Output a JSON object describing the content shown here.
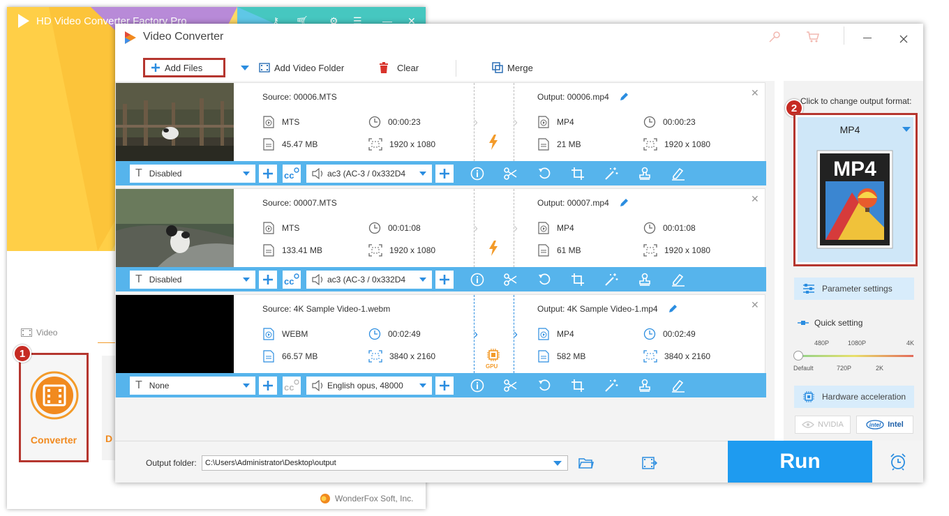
{
  "bg_window": {
    "title": "HD Video Converter Factory Pro",
    "section_label": "Video",
    "converter_label": "Converter",
    "next_label": "D",
    "brand": "WonderFox Soft, Inc.",
    "badge1": "1"
  },
  "window": {
    "title": "Video Converter",
    "toolbar": {
      "add_files": "Add Files",
      "add_folder": "Add Video Folder",
      "clear": "Clear",
      "merge": "Merge"
    }
  },
  "items": [
    {
      "source": "Source: 00006.MTS",
      "src_format": "MTS",
      "src_duration": "00:00:23",
      "src_size": "45.47 MB",
      "src_res": "1920 x 1080",
      "output": "Output: 00006.mp4",
      "out_format": "MP4",
      "out_duration": "00:00:23",
      "out_size": "21 MB",
      "out_res": "1920 x 1080",
      "subtitle": "Disabled",
      "audio": "ac3 (AC-3 / 0x332D4"
    },
    {
      "source": "Source: 00007.MTS",
      "src_format": "MTS",
      "src_duration": "00:01:08",
      "src_size": "133.41 MB",
      "src_res": "1920 x 1080",
      "output": "Output: 00007.mp4",
      "out_format": "MP4",
      "out_duration": "00:01:08",
      "out_size": "61 MB",
      "out_res": "1920 x 1080",
      "subtitle": "Disabled",
      "audio": "ac3 (AC-3 / 0x332D4"
    },
    {
      "source": "Source: 4K Sample Video-1.webm",
      "src_format": "WEBM",
      "src_duration": "00:02:49",
      "src_size": "66.57 MB",
      "src_res": "3840 x 2160",
      "output": "Output: 4K Sample Video-1.mp4",
      "out_format": "MP4",
      "out_duration": "00:02:49",
      "out_size": "582 MB",
      "out_res": "3840 x 2160",
      "subtitle": "None",
      "audio": "English opus, 48000",
      "gpu_label": "GPU"
    }
  ],
  "bottom": {
    "output_label": "Output folder:",
    "output_path": "C:\\Users\\Administrator\\Desktop\\output",
    "run": "Run"
  },
  "right_panel": {
    "click_label": "Click to change output format:",
    "format": "MP4",
    "format_icon_text": "MP4",
    "badge2": "2",
    "parameter_settings": "Parameter settings",
    "quick_setting": "Quick setting",
    "ticks_top": [
      "480P",
      "1080P",
      "4K"
    ],
    "ticks_bottom": [
      "Default",
      "720P",
      "2K"
    ],
    "hardware_acceleration": "Hardware acceleration",
    "nvidia": "NVIDIA",
    "intel": "Intel",
    "intel_logo": "intel"
  },
  "colors": {
    "accent_blue": "#56b4ec",
    "run_blue": "#1e9bf0",
    "highlight_red": "#b5362f",
    "orange": "#f18a1f"
  }
}
